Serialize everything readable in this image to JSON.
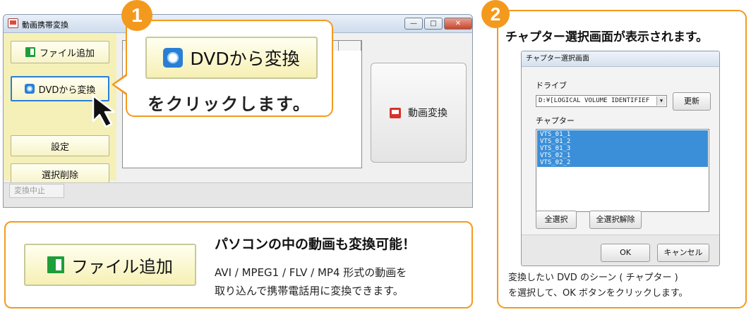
{
  "step1": {
    "number": "1",
    "window": {
      "title": "動画携帯変換",
      "minimize": "—",
      "maximize": "□",
      "close": "✕",
      "buttons": {
        "add_file": "ファイル追加",
        "dvd_convert": "DVDから変換",
        "settings": "設定",
        "delete_selected": "選択削除",
        "convert": "動画変換"
      },
      "status_button": "変換中止"
    },
    "callout": {
      "button_label": "DVDから変換",
      "message": "をクリックします。"
    }
  },
  "file_panel": {
    "button_label": "ファイル追加",
    "headline": "パソコンの中の動画も変換可能！",
    "desc_line1": "AVI / MPEG1 / FLV / MP4 形式の動画を",
    "desc_line2": "取り込んで携帯電話用に変換できます。"
  },
  "step2": {
    "number": "2",
    "heading": "チャプター選択画面が表示されます。",
    "dialog": {
      "title": "チャプター選択画面",
      "drive_label": "ドライブ",
      "drive_value": "D:¥[LOGICAL VOLUME IDENTIFIEF",
      "refresh": "更新",
      "chapter_label": "チャプター",
      "chapters": [
        "VTS_01_1",
        "VTS_01_2",
        "VTS_01_3",
        "VTS_02_1",
        "VTS_02_2"
      ],
      "select_all": "全選択",
      "deselect_all": "全選択解除",
      "ok": "OK",
      "cancel": "キャンセル"
    },
    "note_line1": "変換したい DVD のシーン ( チャプター )",
    "note_line2": "を選択して、OK ボタンをクリックします。"
  },
  "colors": {
    "accent_orange": "#f39a1e",
    "button_yellow": "#f6f0b4",
    "selection_blue": "#3b8fd8"
  }
}
